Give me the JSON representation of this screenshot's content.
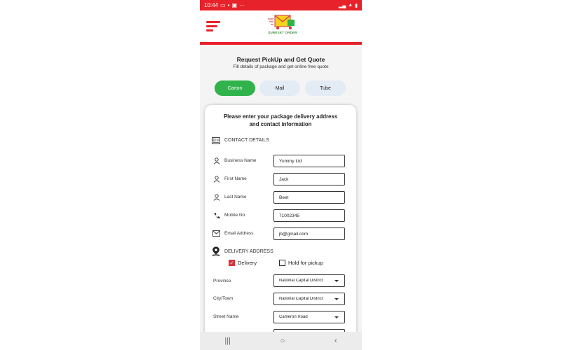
{
  "status_bar": {
    "time": "10:44",
    "dots": "···"
  },
  "brand": {
    "logo_text": "SURESET ORDER",
    "accent": "#e8222a",
    "green": "#2fb34a"
  },
  "page": {
    "title": "Request PickUp and Get Quote",
    "subtitle": "Fill details of package and get online free quote"
  },
  "tabs": [
    {
      "label": "Carton",
      "active": true
    },
    {
      "label": "Mail",
      "active": false
    },
    {
      "label": "Tube",
      "active": false
    }
  ],
  "form": {
    "heading_line1": "Please enter your package delivery address",
    "heading_line2": "and contact information",
    "contact_section": "CONTACT DETAILS",
    "fields": [
      {
        "label": "Business Name",
        "value": "Yummy Ltd",
        "icon": "person-icon"
      },
      {
        "label": "First Name",
        "value": "Jack",
        "icon": "person-icon"
      },
      {
        "label": "Last Name",
        "value": "Beet",
        "icon": "person-icon"
      },
      {
        "label": "Mobile No",
        "value": "71002345",
        "icon": "phone-icon"
      },
      {
        "label": "Email Address",
        "value": "jb@gmail.com",
        "icon": "mail-icon"
      }
    ],
    "delivery_section": "DELIVERY ADDRESS",
    "delivery_option": "Delivery",
    "hold_option": "Hold for pickup",
    "delivery_checked": true,
    "hold_checked": false,
    "selects": [
      {
        "label": "Province",
        "value": "National Capital District"
      },
      {
        "label": "City/Town",
        "value": "National Capital District"
      },
      {
        "label": "Street Name",
        "value": "Cameron Road"
      }
    ]
  },
  "navbar": {
    "recent": "|||",
    "home": "○",
    "back": "‹"
  }
}
